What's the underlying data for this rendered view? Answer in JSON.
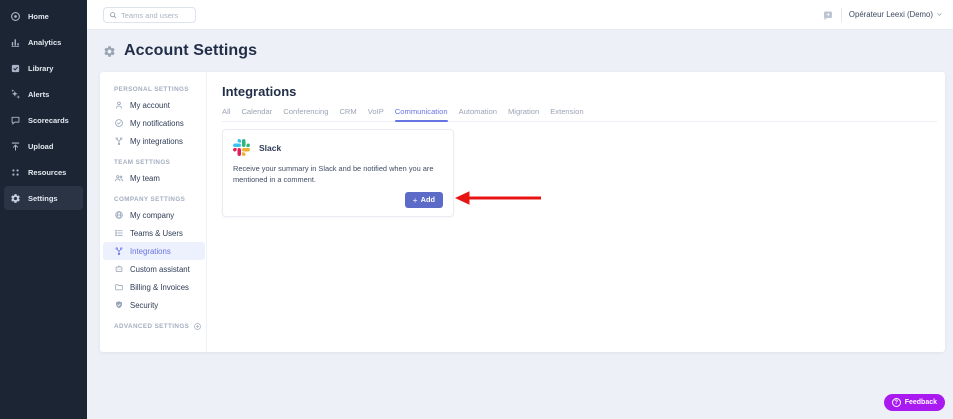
{
  "sidebar": {
    "items": [
      {
        "label": "Home"
      },
      {
        "label": "Analytics"
      },
      {
        "label": "Library"
      },
      {
        "label": "Alerts"
      },
      {
        "label": "Scorecards"
      },
      {
        "label": "Upload"
      },
      {
        "label": "Resources"
      },
      {
        "label": "Settings"
      }
    ],
    "active_item": "Settings"
  },
  "topbar": {
    "search_placeholder": "Teams and users",
    "user_menu_label": "Opérateur Leexi (Demo)"
  },
  "page": {
    "title": "Account Settings"
  },
  "settings_nav": {
    "sections": [
      {
        "header": "Personal settings",
        "items": [
          "My account",
          "My notifications",
          "My integrations"
        ]
      },
      {
        "header": "Team settings",
        "items": [
          "My team"
        ]
      },
      {
        "header": "Company settings",
        "items": [
          "My company",
          "Teams & Users",
          "Integrations",
          "Custom assistant",
          "Billing & Invoices",
          "Security"
        ]
      }
    ],
    "advanced_label": "Advanced settings",
    "active_item": "Integrations"
  },
  "integrations": {
    "title": "Integrations",
    "tabs": [
      "All",
      "Calendar",
      "Conferencing",
      "CRM",
      "VoIP",
      "Communication",
      "Automation",
      "Migration",
      "Extension"
    ],
    "active_tab": "Communication",
    "card": {
      "name": "Slack",
      "description": "Receive your summary in Slack and be notified when you are mentioned in a comment.",
      "add_label": "Add"
    }
  },
  "feedback": {
    "label": "Feedback"
  },
  "colors": {
    "sidebar_bg": "#1c2533",
    "accent_purple": "#6775e3",
    "add_button": "#5c6ac8",
    "feedback_button": "#a81af0",
    "annotation_arrow": "#e81414",
    "slack_blue": "#36C5F0",
    "slack_green": "#2EB67D",
    "slack_red": "#E01E5A",
    "slack_yellow": "#ECB22E"
  },
  "icons": {
    "sidebar": [
      "home-icon",
      "analytics-icon",
      "library-icon",
      "alerts-icon",
      "scorecards-icon",
      "upload-icon",
      "resources-icon",
      "gear-icon"
    ],
    "annotation": "red-arrow-left"
  }
}
